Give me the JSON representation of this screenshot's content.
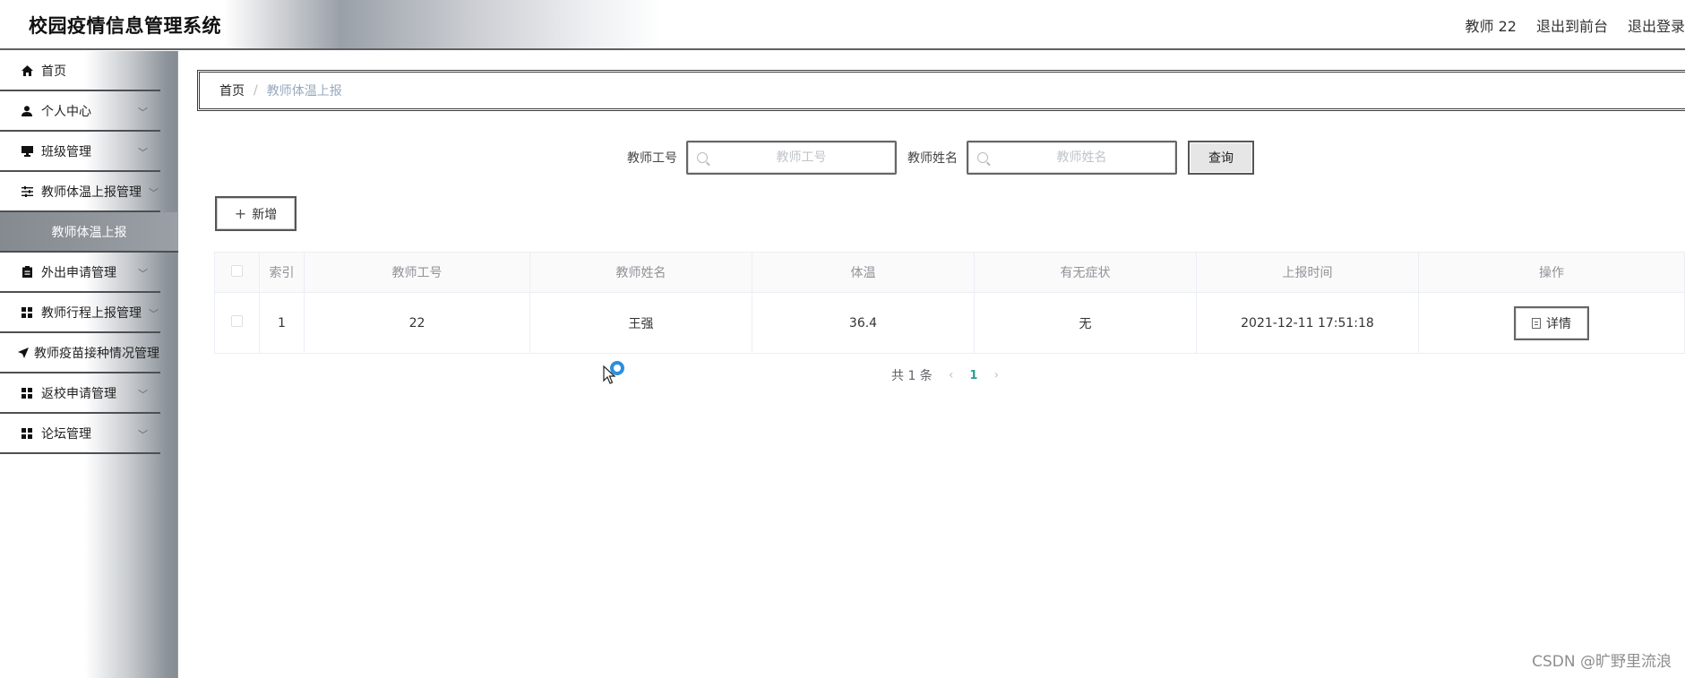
{
  "header": {
    "title": "校园疫情信息管理系统",
    "user": "教师 22",
    "back_front": "退出到前台",
    "logout": "退出登录"
  },
  "sidebar": {
    "items": [
      {
        "label": "首页",
        "icon": "home-icon",
        "has_chevron": false
      },
      {
        "label": "个人中心",
        "icon": "user-icon",
        "has_chevron": true
      },
      {
        "label": "班级管理",
        "icon": "monitor-icon",
        "has_chevron": true
      },
      {
        "label": "教师体温上报管理",
        "icon": "sliders-icon",
        "has_chevron": true
      },
      {
        "label": "教师体温上报",
        "icon": "",
        "has_chevron": false,
        "active": true
      },
      {
        "label": "外出申请管理",
        "icon": "clipboard-icon",
        "has_chevron": true
      },
      {
        "label": "教师行程上报管理",
        "icon": "grid-icon",
        "has_chevron": true
      },
      {
        "label": "教师疫苗接种情况管理",
        "icon": "send-icon",
        "has_chevron": false
      },
      {
        "label": "返校申请管理",
        "icon": "grid-icon",
        "has_chevron": true
      },
      {
        "label": "论坛管理",
        "icon": "grid-icon",
        "has_chevron": true
      }
    ]
  },
  "breadcrumb": {
    "home": "首页",
    "separator": "/",
    "current": "教师体温上报"
  },
  "search": {
    "label1": "教师工号",
    "placeholder1": "教师工号",
    "label2": "教师姓名",
    "placeholder2": "教师姓名",
    "button": "查询"
  },
  "actions": {
    "add": "新增"
  },
  "table": {
    "columns": [
      "索引",
      "教师工号",
      "教师姓名",
      "体温",
      "有无症状",
      "上报时间",
      "操作"
    ],
    "rows": [
      {
        "index": "1",
        "teacher_id": "22",
        "teacher_name": "王强",
        "temperature": "36.4",
        "symptoms": "无",
        "report_time": "2021-12-11 17:51:18",
        "action": "详情"
      }
    ]
  },
  "pagination": {
    "total": "共 1 条",
    "current_page": "1"
  },
  "watermark": "CSDN @旷野里流浪",
  "colors": {
    "active_page": "#2f9e8f",
    "breadcrumb_current": "#97a8be"
  }
}
